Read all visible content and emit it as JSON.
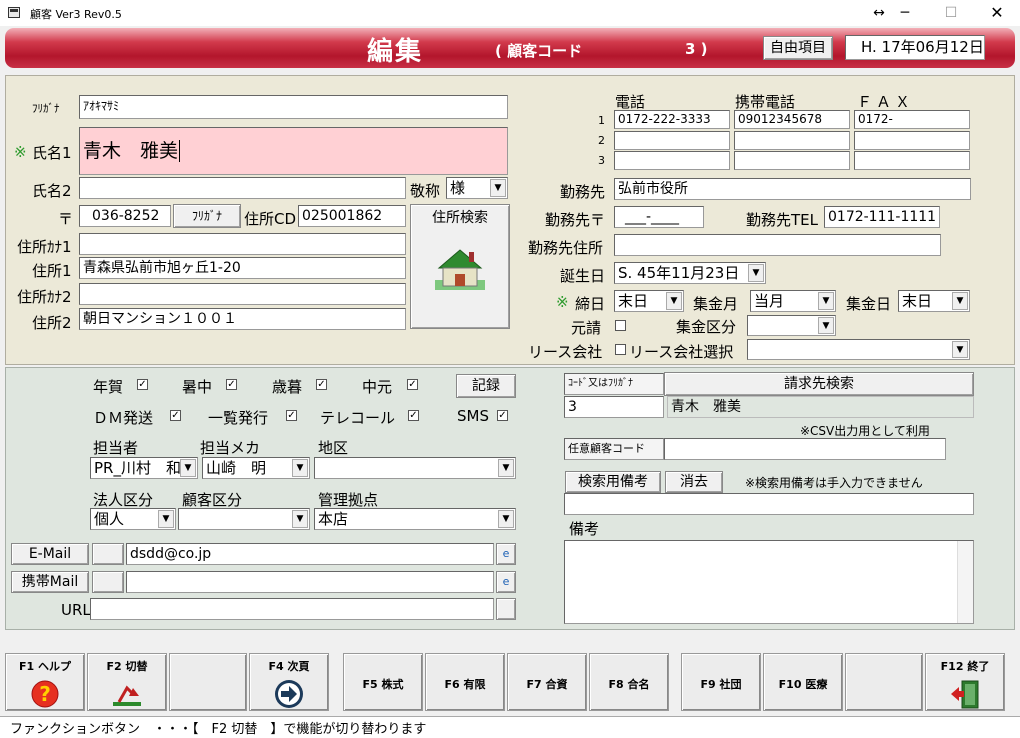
{
  "window": {
    "title": "顧客 Ver3 Rev0.5",
    "restore_glyph": "↔",
    "minimize_glyph": "─",
    "maximize_glyph": "☐",
    "close_glyph": "✕"
  },
  "header": {
    "title": "編集",
    "code_label": "( 顧客コード",
    "code_value": "3 )",
    "free_item_button": "自由項目",
    "date": "H. 17年06月12日"
  },
  "person": {
    "furigana_label": "ﾌﾘｶﾞﾅ",
    "furigana_value": "ｱｵｷﾏｻﾐ",
    "name1_mark": "※",
    "name1_label": "氏名1",
    "name1_value": "青木　雅美",
    "name2_label": "氏名2",
    "name2_value": "",
    "honorific_label": "敬称",
    "honorific_value": "様",
    "postal_label": "〒",
    "postal_value": "036-8252",
    "furigana_button": "ﾌﾘｶﾞﾅ",
    "address_cd_label": "住所CD",
    "address_cd_value": "025001862",
    "address_search_button": "住所検索",
    "address_kana1_label": "住所ｶﾅ1",
    "address_kana1_value": "",
    "address1_label": "住所1",
    "address1_value": "青森県弘前市旭ヶ丘1-20",
    "address_kana2_label": "住所ｶﾅ2",
    "address_kana2_value": "",
    "address2_label": "住所2",
    "address2_value": "朝日マンション１００１"
  },
  "phones": {
    "header_phone": "電話",
    "header_mobile": "携帯電話",
    "header_fax": "ＦＡＸ",
    "rows": [
      {
        "num": "1",
        "phone": "0172-222-3333",
        "mobile": "09012345678",
        "fax": "0172-"
      },
      {
        "num": "2",
        "phone": "",
        "mobile": "",
        "fax": ""
      },
      {
        "num": "3",
        "phone": "",
        "mobile": "",
        "fax": ""
      }
    ]
  },
  "work": {
    "employer_label": "勤務先",
    "employer_value": "弘前市役所",
    "work_postal_label": "勤務先〒",
    "work_postal_value": "___-____",
    "work_tel_label": "勤務先TEL",
    "work_tel_value": "0172-111-1111",
    "work_address_label": "勤務先住所",
    "work_address_value": "",
    "birthday_label": "誕生日",
    "birthday_value": "S. 45年11月23日",
    "closing_mark": "※",
    "closing_label": "締日",
    "closing_value": "末日",
    "collect_month_label": "集金月",
    "collect_month_value": "当月",
    "collect_day_label": "集金日",
    "collect_day_value": "末日",
    "guarantor_label": "元請",
    "collect_class_label": "集金区分",
    "collect_class_value": "",
    "lease_label": "リース会社",
    "lease_select_label": "リース会社選択",
    "lease_select_value": ""
  },
  "mailing": {
    "nenga": "年賀",
    "shochu": "暑中",
    "seibo": "歳暮",
    "chugen": "中元",
    "record_button": "記録",
    "dm": "ＤＭ発送",
    "list_issue": "一覧発行",
    "telecall": "テレコール",
    "sms": "SMS",
    "check_glyph": "✓"
  },
  "assign": {
    "staff_label": "担当者",
    "staff_value": "PR_川村　和",
    "maker_label": "担当メカ",
    "maker_value": "山崎　明",
    "area_label": "地区",
    "area_value": "",
    "corp_label": "法人区分",
    "corp_value": "個人",
    "cust_class_label": "顧客区分",
    "cust_class_value": "",
    "base_label": "管理拠点",
    "base_value": "本店"
  },
  "contact": {
    "email_button": "E-Mail",
    "email_value": "dsdd@co.jp",
    "mobile_mail_button": "携帯Mail",
    "mobile_mail_value": "",
    "url_label": "URL",
    "url_value": "",
    "mail_icon_glyph": "e"
  },
  "billing": {
    "search_key_label": "ｺｰﾄﾞ又はﾌﾘｶﾞﾅ",
    "search_button": "請求先検索",
    "code_value": "3",
    "name_value": "青木　雅美",
    "csv_note": "※CSV出力用として利用",
    "optional_code_label": "任意顧客コード",
    "optional_code_value": "",
    "search_memo_button": "検索用備考",
    "clear_button": "消去",
    "memo_note": "※検索用備考は手入力できません",
    "search_memo_value": "",
    "remarks_label": "備考",
    "remarks_value": ""
  },
  "fkeys": [
    {
      "key": "F1 ヘルプ",
      "icon": "help-icon"
    },
    {
      "key": "F2 切替",
      "icon": "switch-icon"
    },
    {
      "key": "",
      "icon": ""
    },
    {
      "key": "F4 次頁",
      "icon": "next-page-icon"
    },
    {
      "key": "F5 株式",
      "icon": ""
    },
    {
      "key": "F6 有限",
      "icon": ""
    },
    {
      "key": "F7 合資",
      "icon": ""
    },
    {
      "key": "F8 合名",
      "icon": ""
    },
    {
      "key": "F9 社団",
      "icon": ""
    },
    {
      "key": "F10 医療",
      "icon": ""
    },
    {
      "key": "",
      "icon": ""
    },
    {
      "key": "F12 終了",
      "icon": "exit-icon"
    }
  ],
  "status_text": "ファンクションボタン　・・・【　F2 切替　】で機能が切り替わります",
  "colors": {
    "banner": "#c0283c",
    "name_bg": "#ffd0d4",
    "mark": "#2c9a2c"
  }
}
